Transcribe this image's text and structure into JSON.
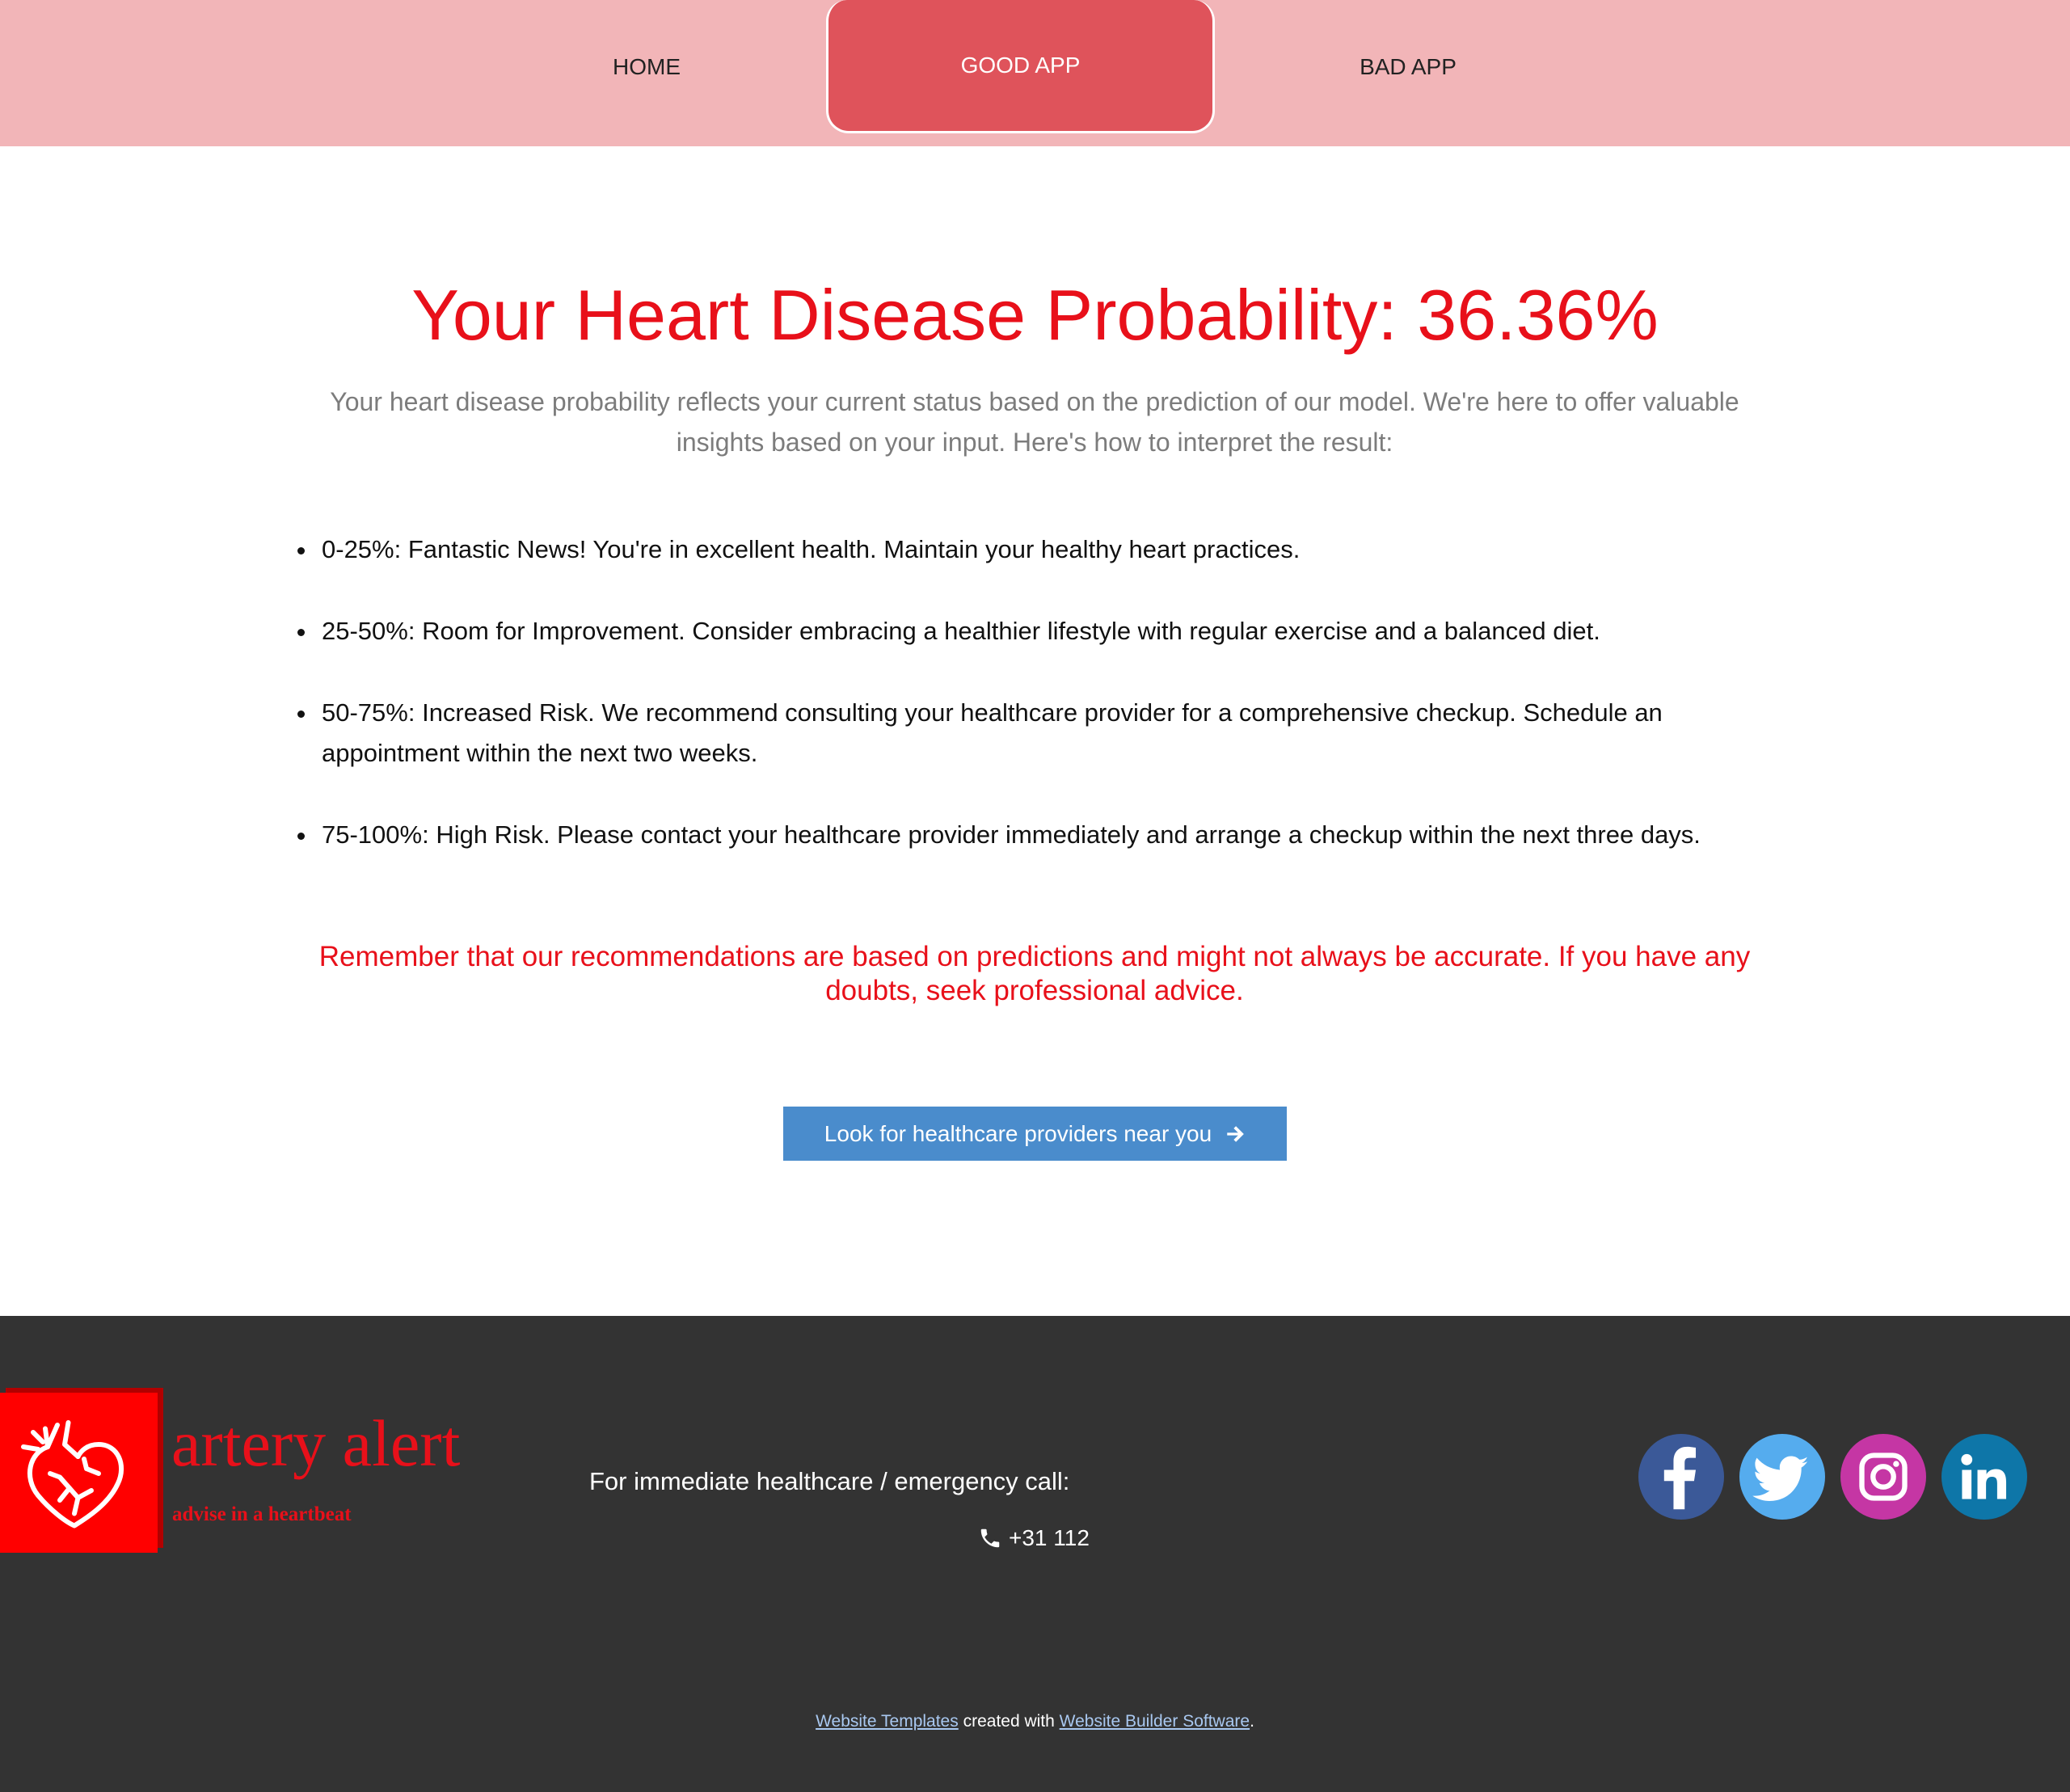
{
  "nav": {
    "items": [
      {
        "label": "HOME"
      },
      {
        "label": "GOOD APP",
        "active": true
      },
      {
        "label": "BAD APP"
      }
    ]
  },
  "main": {
    "title_prefix": "Your Heart Disease Probability:",
    "probability": "36.36%",
    "intro": "Your heart disease probability reflects your current status based on the prediction of our model. We're here to offer valuable insights based on your input. Here's how to interpret the result:",
    "ranges": [
      "0-25%: Fantastic News! You're in excellent health. Maintain your healthy heart practices.",
      "25-50%: Room for Improvement. Consider embracing a healthier lifestyle with regular exercise and a balanced diet.",
      "50-75%: Increased Risk. We recommend consulting your healthcare provider for a comprehensive checkup. Schedule an appointment within the next two weeks.",
      "75-100%: High Risk. Please contact your healthcare provider immediately and arrange a checkup within the next three days."
    ],
    "disclaimer": "Remember that our recommendations are based on predictions and might not always be accurate. If you have any doubts, seek professional advice.",
    "cta_label": "Look for healthcare providers near you",
    "cta_icon": "arrow-right-icon"
  },
  "footer": {
    "brand_name": "artery alert",
    "brand_tagline": "advise in a heartbeat",
    "emergency_label": "For immediate healthcare / emergency call:",
    "phone_number": "+31 112",
    "social": [
      {
        "name": "facebook-icon",
        "color": "#3b5998"
      },
      {
        "name": "twitter-icon",
        "color": "#55acee"
      },
      {
        "name": "instagram-icon",
        "color": "#c536a4"
      },
      {
        "name": "linkedin-icon",
        "color": "#0e76a8"
      }
    ],
    "credits": {
      "link1": "Website Templates",
      "middle": "created with",
      "link2": "Website Builder Software",
      "end": "."
    }
  },
  "colors": {
    "nav_bg": "#f2b5b8",
    "nav_active": "#df535b",
    "accent_red": "#e8101a",
    "button_blue": "#4a8ccc",
    "footer_bg": "#333333"
  }
}
